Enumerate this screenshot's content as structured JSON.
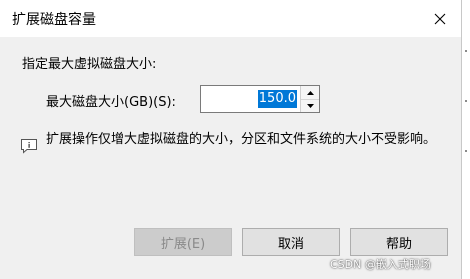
{
  "dialog": {
    "title": "扩展磁盘容量",
    "prompt": "指定最大虚拟磁盘大小:",
    "size_label": "最大磁盘大小(GB)(S):",
    "size_value": "150.0",
    "info_text": "扩展操作仅增大虚拟磁盘的大小，分区和文件系统的大小不受影响。",
    "buttons": {
      "expand": "扩展(E)",
      "cancel": "取消",
      "help": "帮助"
    },
    "expand_enabled": false
  },
  "watermark": "CSDN @嵌入式职场",
  "icons": {
    "close": "close-icon",
    "spin_up": "chevron-up-icon",
    "spin_down": "chevron-down-icon",
    "info": "info-comment-icon"
  },
  "colors": {
    "selection": "#0078d7",
    "titlebar": "#ffffff",
    "dialog_bg": "#f0f0f0"
  }
}
